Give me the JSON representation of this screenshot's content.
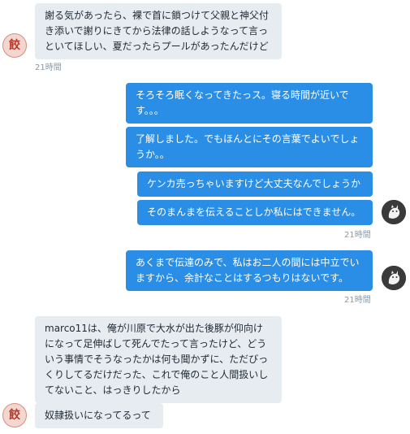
{
  "messages": {
    "m1": {
      "text": "謝る気があったら、裸で首に鎖つけて父親と神父付き添いで謝りにきてから法律の話しようなって言っといてほしい、夏だったらプールがあったんだけど",
      "timestamp": "21時間"
    },
    "m2": {
      "text": "そろそろ眠くなってきたっス。寝る時間が近いです。。。"
    },
    "m3": {
      "text": "了解しました。でもほんとにその言葉でよいでしょうか。。"
    },
    "m4": {
      "text": "ケンカ売っちゃいますけど大丈夫なんでしょうか"
    },
    "m5": {
      "text": "そのまんまを伝えることしか私にはできません。",
      "timestamp": "21時間"
    },
    "m6": {
      "text": "あくまで伝達のみで、私はお二人の間には中立でいますから、余計なことはするつもりはないです。",
      "timestamp": "21時間"
    },
    "m7": {
      "text": "marco11は、俺が川原で大水が出た後豚が仰向けになって足伸ばして死んでたって言ったけど、どういう事情でそうなったかは何も聞かずに、ただびっくりしてるだけだった、これで俺のこと人間扱いしてないこと、はっきりしたから"
    },
    "m8": {
      "text": "奴隷扱いになってるって"
    }
  },
  "avatars": {
    "other_glyph": "餃"
  },
  "colors": {
    "incoming_bubble": "#e6ecf0",
    "outgoing_bubble": "#2b8ee6",
    "timestamp": "#8899a6"
  }
}
